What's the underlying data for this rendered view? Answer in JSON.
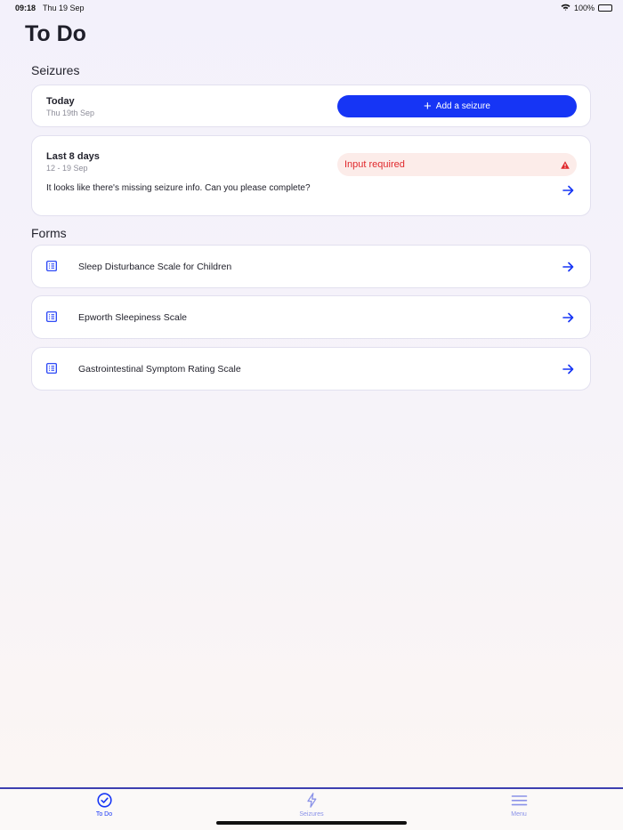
{
  "status_bar": {
    "time": "09:18",
    "date": "Thu 19 Sep",
    "battery": "100%"
  },
  "page": {
    "title": "To Do"
  },
  "seizures_section": {
    "title": "Seizures",
    "today_card": {
      "title": "Today",
      "subtitle": "Thu 19th Sep",
      "button_label": "Add a seizure"
    },
    "last_days_card": {
      "title": "Last 8 days",
      "subtitle": "12 - 19 Sep",
      "warning": "Input required",
      "message": "It looks like there's missing seizure info. Can you please complete?"
    }
  },
  "forms_section": {
    "title": "Forms",
    "items": [
      {
        "label": "Sleep Disturbance Scale for Children"
      },
      {
        "label": "Epworth Sleepiness Scale"
      },
      {
        "label": "Gastrointestinal Symptom Rating Scale"
      }
    ]
  },
  "tab_bar": {
    "tabs": [
      {
        "label": "To Do",
        "icon": "check-circle-icon",
        "active": true
      },
      {
        "label": "Seizures",
        "icon": "lightning-icon",
        "active": false
      },
      {
        "label": "Menu",
        "icon": "menu-icon",
        "active": false
      }
    ]
  },
  "colors": {
    "accent": "#1635f5",
    "warning": "#e0282c",
    "warning_bg": "#fcece9",
    "inactive_tab": "#8a92e8"
  }
}
